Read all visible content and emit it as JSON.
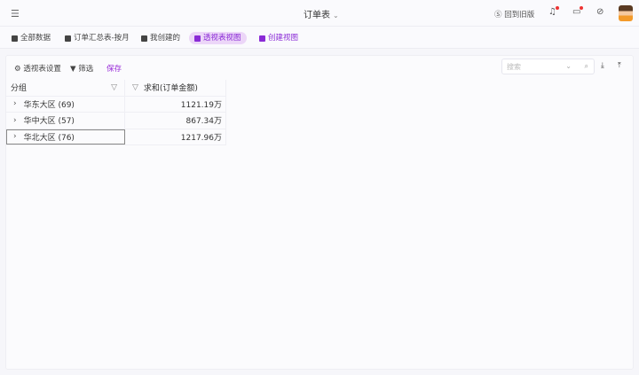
{
  "header": {
    "title": "订单表",
    "back_old": "回到旧版"
  },
  "tabs": [
    {
      "label": "全部数据"
    },
    {
      "label": "订单汇总表-按月"
    },
    {
      "label": "我创建的"
    },
    {
      "label": "透视表视图",
      "active": true
    },
    {
      "label": "创建视图"
    }
  ],
  "toolbar": {
    "settings": "透视表设置",
    "filter": "筛选",
    "save": "保存",
    "search_placeholder": "搜索"
  },
  "table": {
    "headers": [
      "分组",
      "求和(订单金额)"
    ],
    "rows": [
      {
        "group": "华东大区 (69)",
        "value": "1121.19万"
      },
      {
        "group": "华中大区 (57)",
        "value": "867.34万"
      },
      {
        "group": "华北大区 (76)",
        "value": "1217.96万"
      }
    ]
  }
}
